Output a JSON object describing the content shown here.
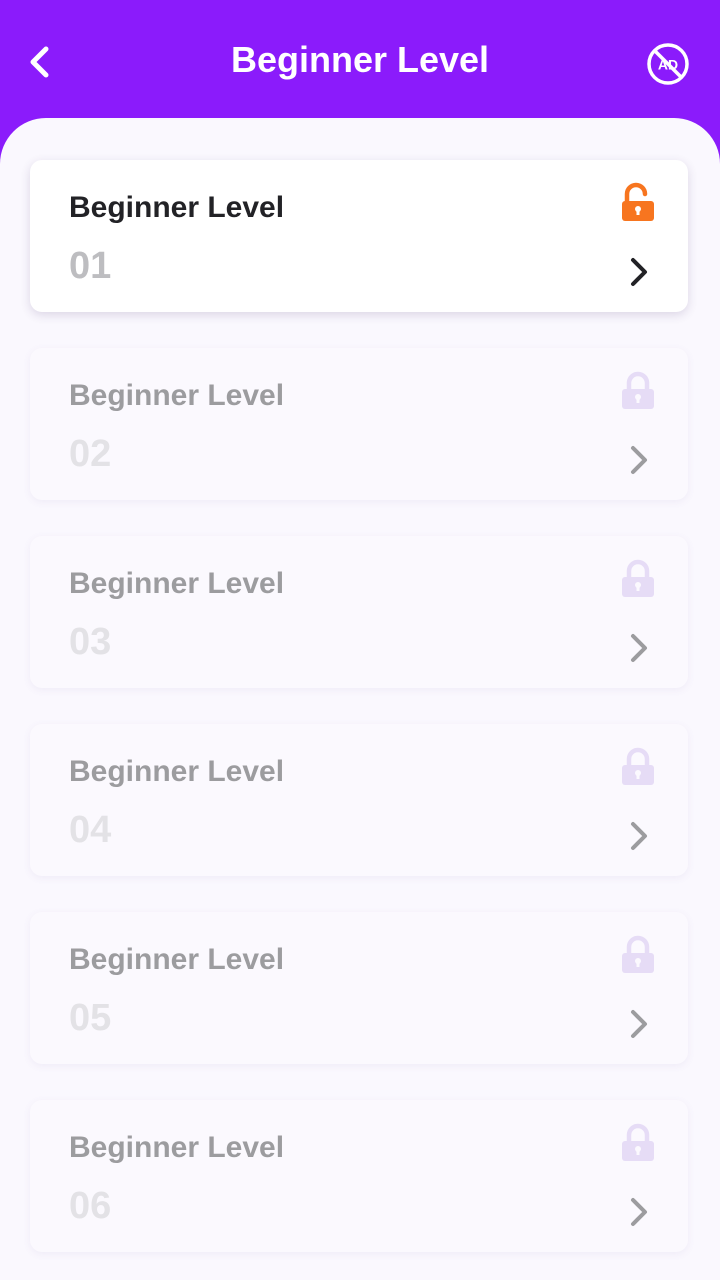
{
  "header": {
    "title": "Beginner Level",
    "back_icon": "chevron-left-icon",
    "noad_icon": "no-ads-icon",
    "noad_text": "AD"
  },
  "colors": {
    "header_bg": "#8b1bfb",
    "content_bg": "#faf8fe",
    "unlocked": "#f7751f",
    "locked": "#e6dcf6"
  },
  "levels": [
    {
      "label": "Beginner Level",
      "number": "01",
      "state": "unlocked"
    },
    {
      "label": "Beginner Level",
      "number": "02",
      "state": "locked"
    },
    {
      "label": "Beginner Level",
      "number": "03",
      "state": "locked"
    },
    {
      "label": "Beginner Level",
      "number": "04",
      "state": "locked"
    },
    {
      "label": "Beginner Level",
      "number": "05",
      "state": "locked"
    },
    {
      "label": "Beginner Level",
      "number": "06",
      "state": "locked"
    }
  ]
}
